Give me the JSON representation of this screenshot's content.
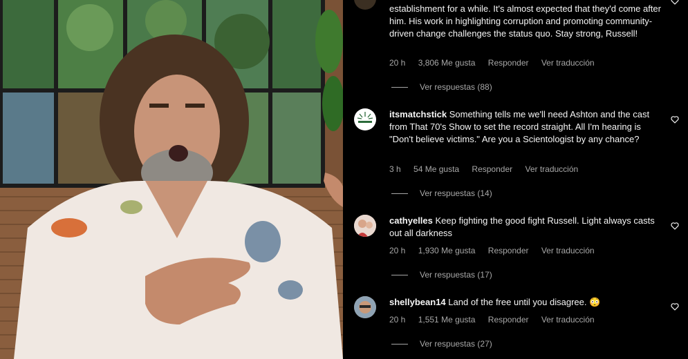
{
  "comments": [
    {
      "text": "establishment for a while. It's almost expected that they'd come after him. His work in highlighting corruption and promoting community-driven change challenges the status quo. Stay strong, Russell!",
      "time": "20 h",
      "likes": "3,806 Me gusta",
      "reply_label": "Responder",
      "translate_label": "Ver traducción",
      "view_replies": "Ver respuestas (88)"
    },
    {
      "username": "itsmatchstick",
      "text": "Something tells me we'll need Ashton and the cast from That 70's Show to set the record straight. All I'm hearing is \"Don't believe victims.\" Are you a Scientologist by any chance?",
      "time": "3 h",
      "likes": "54 Me gusta",
      "reply_label": "Responder",
      "translate_label": "Ver traducción",
      "view_replies": "Ver respuestas (14)"
    },
    {
      "username": "cathyelles",
      "text": "Keep fighting the good fight Russell. Light always casts out all darkness",
      "time": "20 h",
      "likes": "1,930 Me gusta",
      "reply_label": "Responder",
      "translate_label": "Ver traducción",
      "view_replies": "Ver respuestas (17)"
    },
    {
      "username": "shellybean14",
      "text": "Land of the free until you disagree. 😳",
      "time": "20 h",
      "likes": "1,551 Me gusta",
      "reply_label": "Responder",
      "translate_label": "Ver traducción",
      "view_replies": "Ver respuestas (27)"
    }
  ],
  "icons": {
    "like": "heart-outline-icon"
  },
  "colors": {
    "background": "#000000",
    "text": "#f5f5f5",
    "secondary": "#a8a8a8"
  }
}
